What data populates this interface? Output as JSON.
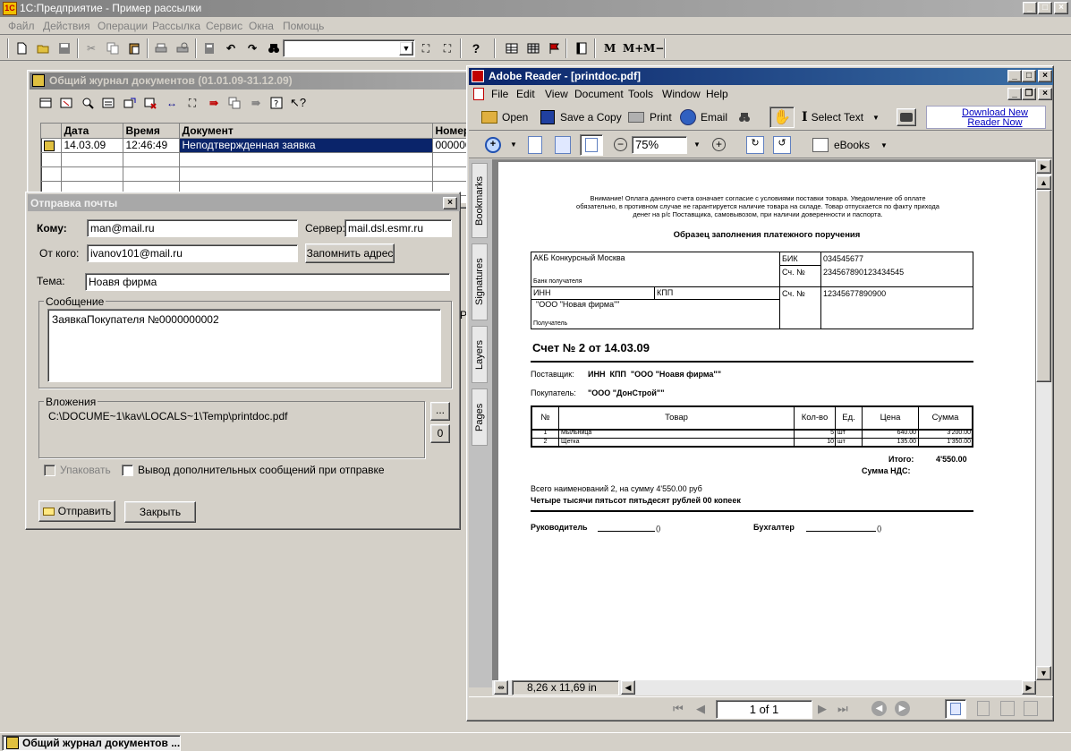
{
  "app": {
    "title": "1С:Предприятие - Пример рассылки",
    "menu": [
      "Файл",
      "Действия",
      "Операции",
      "Рассылка",
      "Сервис",
      "Окна",
      "Помощь"
    ],
    "toolbar_m_buttons": [
      "M",
      "M+",
      "M−"
    ]
  },
  "journal": {
    "title": "Общий журнал документов (01.01.09-31.12.09)",
    "columns": [
      "Дата",
      "Время",
      "Документ",
      "Номер"
    ],
    "rows": [
      {
        "date": "14.03.09",
        "time": "12:46:49",
        "doc": "Неподтвержденная заявка",
        "num": "000000"
      }
    ],
    "side_letter": "Р"
  },
  "mail": {
    "title": "Отправка почты",
    "to_label": "Кому:",
    "to_value": "man@mail.ru",
    "server_label": "Сервер:",
    "server_value": "mail.dsl.esmr.ru",
    "from_label": "От кого:",
    "from_value": "ivanov101@mail.ru",
    "remember_button": "Запомнить адрес",
    "subject_label": "Тема:",
    "subject_value": "Ноавя фирма",
    "message_group": "Сообщение",
    "message_value": "ЗаявкаПокупателя №0000000002",
    "attachments_group": "Вложения",
    "attachment_path": "C:\\DOCUME~1\\kav\\LOCALS~1\\Temp\\printdoc.pdf",
    "browse_button": "...",
    "zero_button": "0",
    "pack_label": "Упаковать",
    "verbose_label": "Вывод дополнительных сообщений при отправке",
    "send_button": "Отправить",
    "close_button": "Закрыть"
  },
  "reader": {
    "title": "Adobe Reader - [printdoc.pdf]",
    "menu": [
      "File",
      "Edit",
      "View",
      "Document",
      "Tools",
      "Window",
      "Help"
    ],
    "toolbar": {
      "open": "Open",
      "save": "Save a Copy",
      "print": "Print",
      "email": "Email",
      "select_text": "Select Text",
      "download": "Download New Reader Now",
      "zoom": "75%",
      "ebooks": "eBooks"
    },
    "tabs": [
      "Bookmarks",
      "Signatures",
      "Layers",
      "Pages"
    ],
    "page_size": "8,26 x 11,69 in",
    "page_nav": "1 of 1"
  },
  "invoice": {
    "notice": "Внимание! Оплата данного счета означает согласие с условиями поставки товара. Уведомление об оплате обязательно, в противном случае не гарантируется наличие товара на складе. Товар отпускается по факту прихода денег на р/с Поставщика, самовывозом, при наличии доверенности и паспорта.",
    "sample_title": "Образец заполнения платежного поручения",
    "bank_name": "АКБ Конкурсный Москва",
    "bik_label": "БИК",
    "bik_value": "034545677",
    "acc_label": "Сч. №",
    "acc1_value": "234567890123434545",
    "bank_recipient_label": "Банк получателя",
    "inn_label": "ИНН",
    "kpp_label": "КПП",
    "acc2_value": "12345677890900",
    "recipient_name": "\"ООО \"Новая фирма\"\"",
    "recipient_label": "Получатель",
    "invoice_title": "Счет № 2 от 14.03.09",
    "supplier_label": "Поставщик:",
    "supplier_value": "ИНН  КПП  \"ООО \"Ноавя фирма\"\"",
    "buyer_label": "Покупатель:",
    "buyer_value": "\"ООО \"ДонСтрой\"\"",
    "columns": [
      "№",
      "Товар",
      "Кол-во",
      "Ед.",
      "Цена",
      "Сумма"
    ],
    "items": [
      {
        "n": "1",
        "name": "Мыльница",
        "qty": "5",
        "unit": "шт",
        "price": "640.00",
        "sum": "3'200.00"
      },
      {
        "n": "2",
        "name": "Щетка",
        "qty": "10",
        "unit": "шт",
        "price": "135.00",
        "sum": "1'350.00"
      }
    ],
    "total_label": "Итого:",
    "total_value": "4'550.00",
    "vat_label": "Сумма НДС:",
    "count_text": "Всего наименований 2, на сумму 4'550.00 руб",
    "words_text": "Четыре тысячи пятьсот пятьдесят рублей 00 копеек",
    "director_label": "Руководитель",
    "accountant_label": "Бухгалтер",
    "paren": "()"
  },
  "taskbar": {
    "item": "Общий журнал документов ..."
  }
}
